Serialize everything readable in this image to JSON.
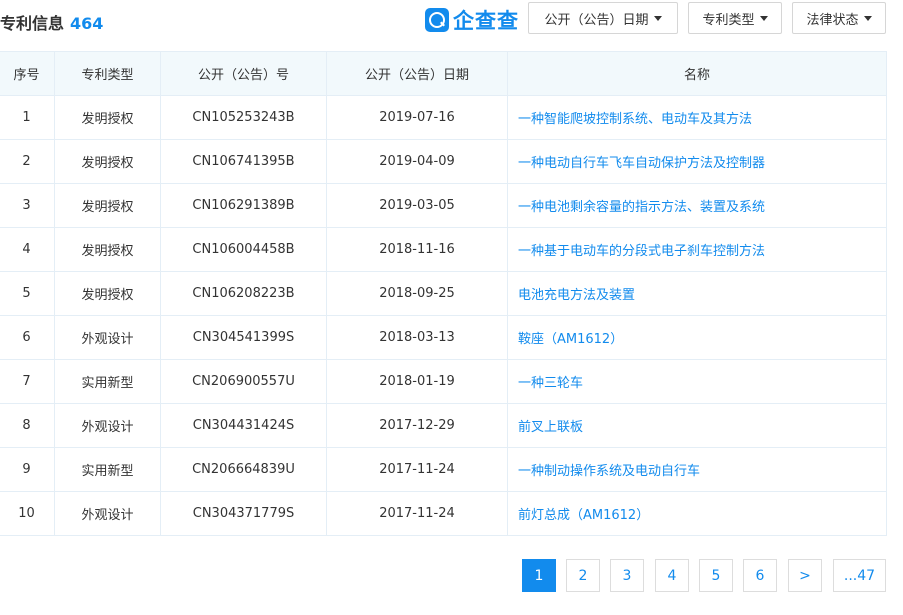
{
  "header": {
    "title": "专利信息",
    "count": "464",
    "logo_text": "企查查",
    "filters": [
      {
        "label": "公开（公告）日期"
      },
      {
        "label": "专利类型"
      },
      {
        "label": "法律状态"
      }
    ]
  },
  "table": {
    "columns": [
      "序号",
      "专利类型",
      "公开（公告）号",
      "公开（公告）日期",
      "名称"
    ],
    "rows": [
      {
        "no": "1",
        "type": "发明授权",
        "pub_no": "CN105253243B",
        "date": "2019-07-16",
        "name": "一种智能爬坡控制系统、电动车及其方法"
      },
      {
        "no": "2",
        "type": "发明授权",
        "pub_no": "CN106741395B",
        "date": "2019-04-09",
        "name": "一种电动自行车飞车自动保护方法及控制器"
      },
      {
        "no": "3",
        "type": "发明授权",
        "pub_no": "CN106291389B",
        "date": "2019-03-05",
        "name": "一种电池剩余容量的指示方法、装置及系统"
      },
      {
        "no": "4",
        "type": "发明授权",
        "pub_no": "CN106004458B",
        "date": "2018-11-16",
        "name": "一种基于电动车的分段式电子刹车控制方法"
      },
      {
        "no": "5",
        "type": "发明授权",
        "pub_no": "CN106208223B",
        "date": "2018-09-25",
        "name": "电池充电方法及装置"
      },
      {
        "no": "6",
        "type": "外观设计",
        "pub_no": "CN304541399S",
        "date": "2018-03-13",
        "name": "鞍座（AM1612）"
      },
      {
        "no": "7",
        "type": "实用新型",
        "pub_no": "CN206900557U",
        "date": "2018-01-19",
        "name": "一种三轮车"
      },
      {
        "no": "8",
        "type": "外观设计",
        "pub_no": "CN304431424S",
        "date": "2017-12-29",
        "name": "前叉上联板"
      },
      {
        "no": "9",
        "type": "实用新型",
        "pub_no": "CN206664839U",
        "date": "2017-11-24",
        "name": "一种制动操作系统及电动自行车"
      },
      {
        "no": "10",
        "type": "外观设计",
        "pub_no": "CN304371779S",
        "date": "2017-11-24",
        "name": "前灯总成（AM1612）"
      }
    ]
  },
  "pagination": {
    "pages": [
      "1",
      "2",
      "3",
      "4",
      "5",
      "6",
      ">",
      "...47"
    ],
    "current": "1"
  },
  "colors": {
    "accent": "#128bed",
    "header_bg": "#f2f9fc",
    "border": "#e4eef6"
  }
}
